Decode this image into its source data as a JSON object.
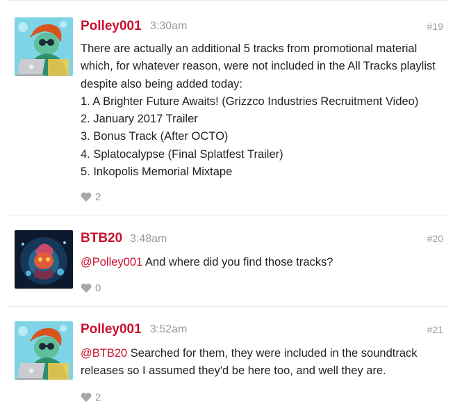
{
  "posts": [
    {
      "username": "Polley001",
      "time": "3:30am",
      "post_number": "#19",
      "avatar_icon": "laptop-character-avatar",
      "lines": [
        "There are actually an additional 5 tracks from promotional material",
        "which, for whatever reason, were not included in the All Tracks playlist",
        "despite also being added today:",
        "1. A Brighter Future Awaits! (Grizzco Industries Recruitment Video)",
        "2. January 2017 Trailer",
        "3. Bonus Track (After OCTO)",
        "4. Splatocalypse (Final Splatfest Trailer)",
        "5. Inkopolis Memorial Mixtape"
      ],
      "likes": "2"
    },
    {
      "username": "BTB20",
      "time": "3:48am",
      "post_number": "#20",
      "avatar_icon": "glowing-boss-avatar",
      "mention": "@Polley001",
      "text": " And where did you find those tracks?",
      "likes": "0"
    },
    {
      "username": "Polley001",
      "time": "3:52am",
      "post_number": "#21",
      "avatar_icon": "laptop-character-avatar",
      "mention": "@BTB20",
      "line1_rest": " Searched for them, they were included in the soundtrack",
      "line2": "releases so I assumed they'd be here too, and well they are.",
      "likes": "2"
    }
  ],
  "colors": {
    "username": "#c8102e",
    "meta_gray": "#9a9a9a",
    "text": "#222222",
    "divider": "#e8e8e8"
  }
}
